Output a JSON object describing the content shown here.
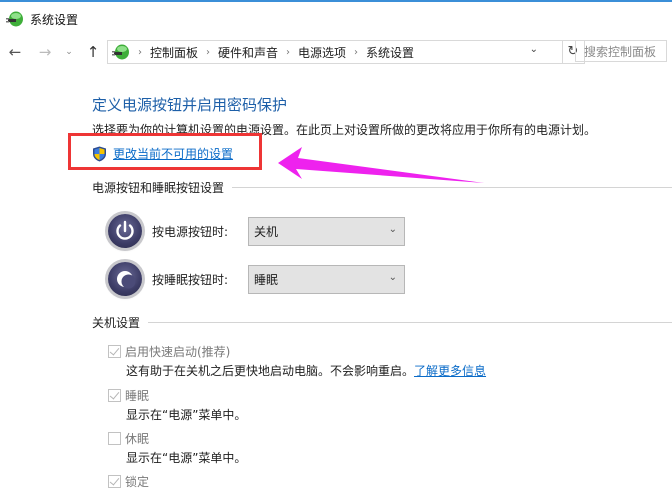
{
  "window": {
    "title": "系统设置",
    "icon": "power-options-icon"
  },
  "nav": {
    "back_icon": "←",
    "forward_icon": "→",
    "recent_icon": "⌄",
    "up_icon": "↑",
    "breadcrumb": [
      "控制面板",
      "硬件和声音",
      "电源选项",
      "系统设置"
    ],
    "breadcrumb_separator": "›",
    "dropdown_icon": "⌄",
    "refresh_icon": "↻",
    "search_placeholder": "搜索控制面板"
  },
  "main": {
    "title": "定义电源按钮并启用密码保护",
    "description": "选择要为你的计算机设置的电源设置。在此页上对设置所做的更改将应用于你所有的电源计划。",
    "change_link": "更改当前不可用的设置",
    "power_section": {
      "heading": "电源按钮和睡眠按钮设置",
      "rows": [
        {
          "label": "按电源按钮时:",
          "value": "关机",
          "icon": "power-button-icon"
        },
        {
          "label": "按睡眠按钮时:",
          "value": "睡眠",
          "icon": "sleep-button-icon"
        }
      ]
    },
    "shutdown_section": {
      "heading": "关机设置",
      "items": [
        {
          "label": "启用快速启动(推荐)",
          "checked": true,
          "description": "这有助于在关机之后更快地启动电脑。不会影响重启。",
          "link": "了解更多信息"
        },
        {
          "label": "睡眠",
          "checked": true,
          "description": "显示在“电源”菜单中。"
        },
        {
          "label": "休眠",
          "checked": false,
          "description": "显示在“电源”菜单中。"
        },
        {
          "label": "锁定",
          "checked": true
        }
      ]
    }
  },
  "annotation": {
    "highlight_color": "#ee3535",
    "arrow_color": "#ee22ee"
  }
}
